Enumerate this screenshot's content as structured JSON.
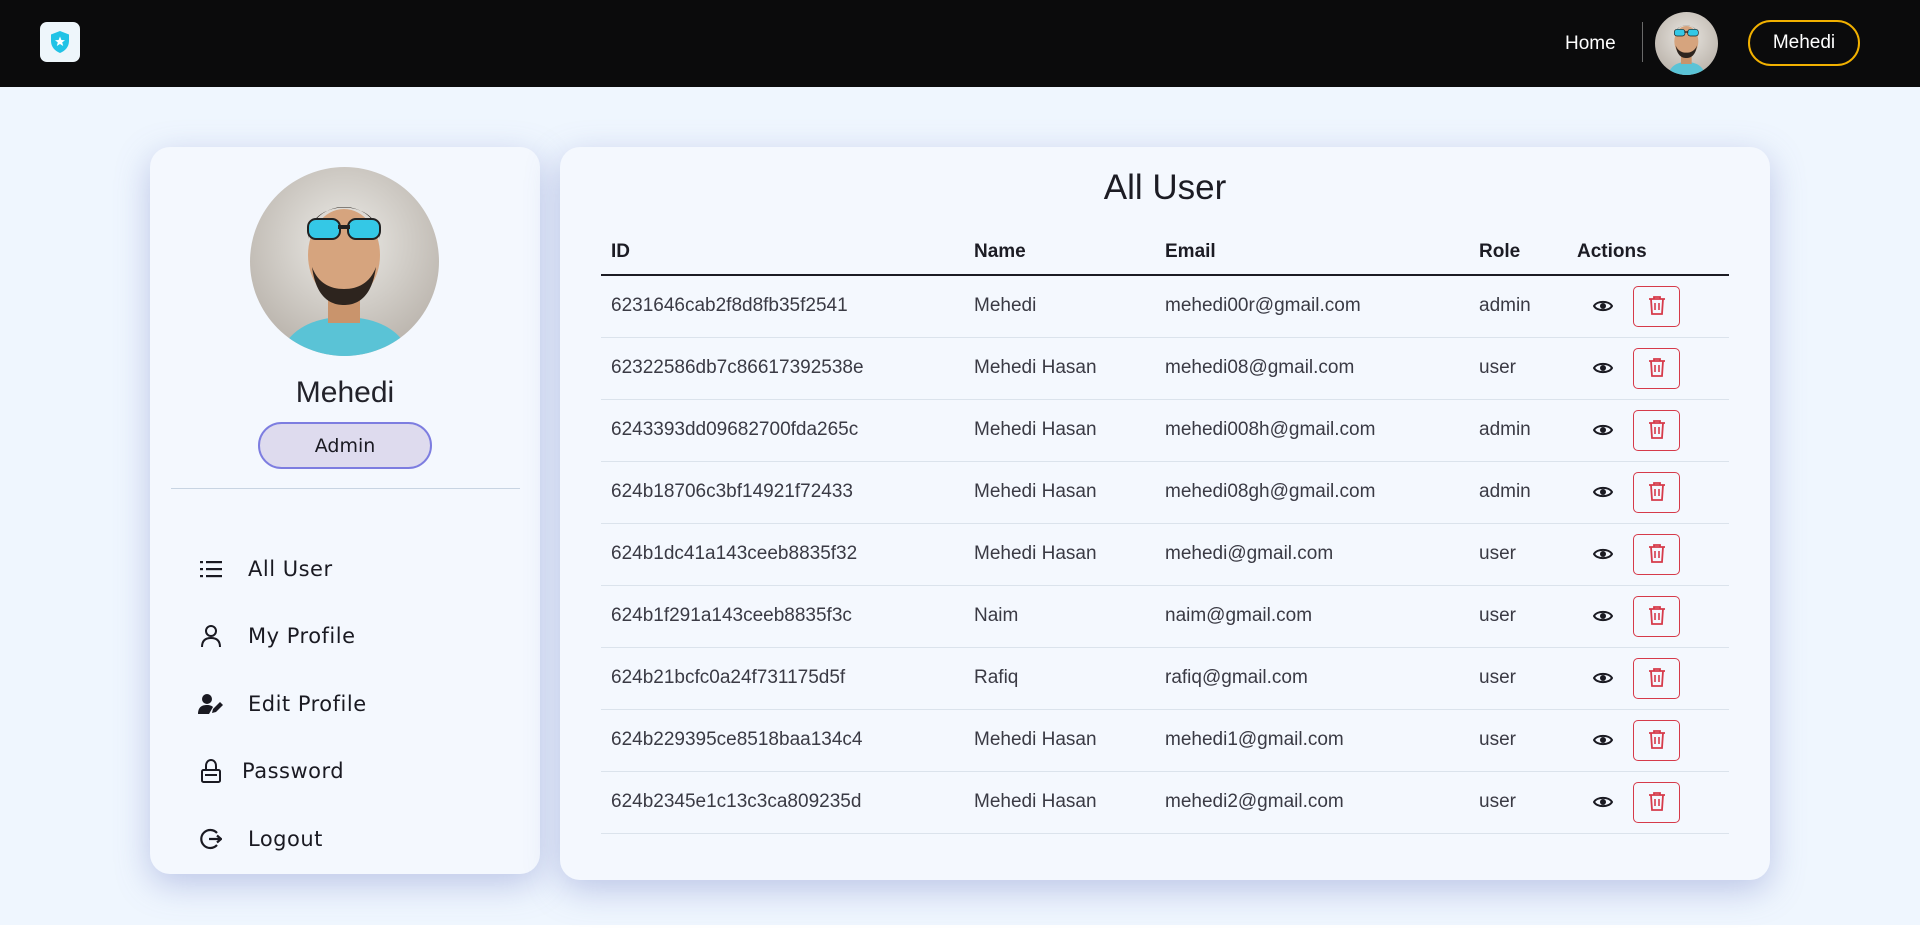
{
  "navbar": {
    "home_label": "Home",
    "user_button_label": "Mehedi"
  },
  "sidebar": {
    "profile_name": "Mehedi",
    "role_badge": "Admin",
    "menu": [
      {
        "label": "All User",
        "icon": "list-icon"
      },
      {
        "label": "My Profile",
        "icon": "user-icon"
      },
      {
        "label": "Edit Profile",
        "icon": "user-edit-icon"
      },
      {
        "label": "Password",
        "icon": "lock-icon"
      },
      {
        "label": "Logout",
        "icon": "logout-icon"
      }
    ]
  },
  "main": {
    "title": "All User",
    "columns": [
      "ID",
      "Name",
      "Email",
      "Role",
      "Actions"
    ],
    "rows": [
      {
        "id": "6231646cab2f8d8fb35f2541",
        "name": "Mehedi",
        "email": "mehedi00r@gmail.com",
        "role": "admin"
      },
      {
        "id": "62322586db7c86617392538e",
        "name": "Mehedi Hasan",
        "email": "mehedi08@gmail.com",
        "role": "user"
      },
      {
        "id": "6243393dd09682700fda265c",
        "name": "Mehedi Hasan",
        "email": "mehedi008h@gmail.com",
        "role": "admin"
      },
      {
        "id": "624b18706c3bf14921f72433",
        "name": "Mehedi Hasan",
        "email": "mehedi08gh@gmail.com",
        "role": "admin"
      },
      {
        "id": "624b1dc41a143ceeb8835f32",
        "name": "Mehedi Hasan",
        "email": "mehedi@gmail.com",
        "role": "user"
      },
      {
        "id": "624b1f291a143ceeb8835f3c",
        "name": "Naim",
        "email": "naim@gmail.com",
        "role": "user"
      },
      {
        "id": "624b21bcfc0a24f731175d5f",
        "name": "Rafiq",
        "email": "rafiq@gmail.com",
        "role": "user"
      },
      {
        "id": "624b229395ce8518baa134c4",
        "name": "Mehedi Hasan",
        "email": "mehedi1@gmail.com",
        "role": "user"
      },
      {
        "id": "624b2345e1c13c3ca809235d",
        "name": "Mehedi Hasan",
        "email": "mehedi2@gmail.com",
        "role": "user"
      }
    ]
  },
  "colors": {
    "navbar_bg": "#0b0b0c",
    "accent_gold": "#f2b100",
    "page_bg": "#eff6fe",
    "card_bg": "#f4f8fe",
    "badge_border": "#7d7de0",
    "badge_bg": "#dedbee",
    "delete_red": "#d63a4a"
  }
}
